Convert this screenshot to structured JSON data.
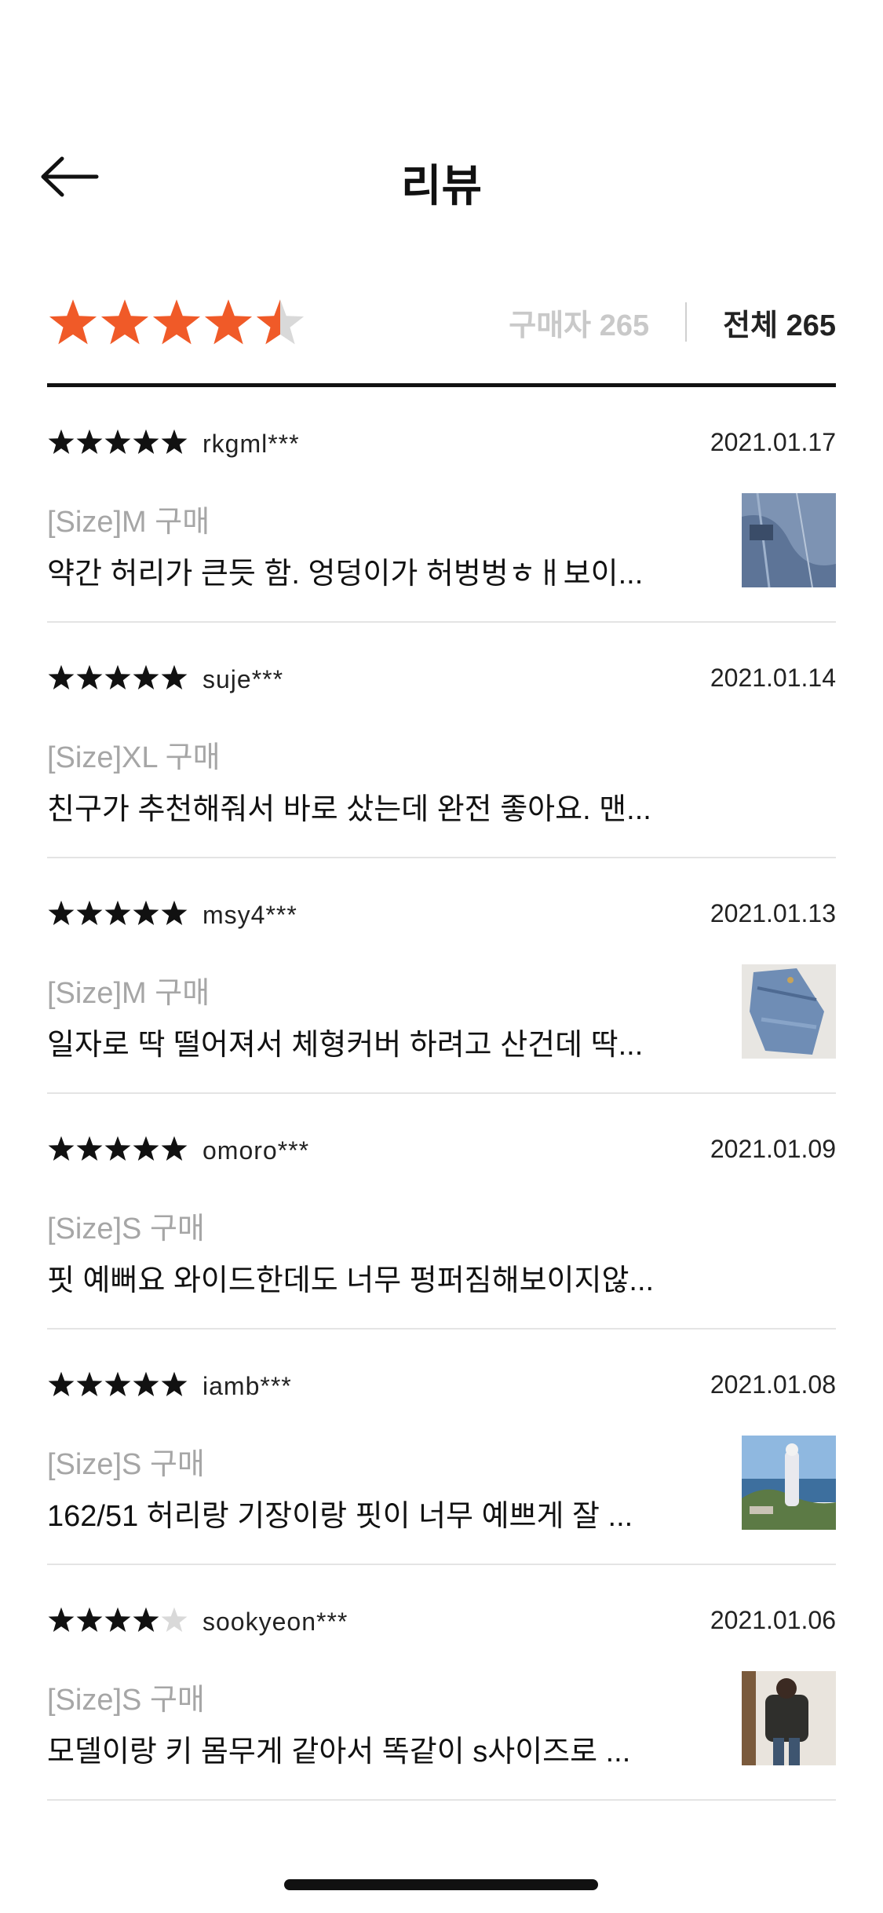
{
  "header": {
    "title": "리뷰",
    "back_icon": "arrow-left-icon"
  },
  "summary": {
    "rating": 4.5,
    "max_rating": 5,
    "star_color": "#f05a28",
    "filters": {
      "buyer_label": "구매자 265",
      "all_label": "전체 265"
    }
  },
  "reviews": [
    {
      "rating": 5,
      "user": "rkgml***",
      "date": "2021.01.17",
      "option": "[Size]M 구매",
      "text": "약간 허리가 큰듯 함. 엉덩이가 허벙벙ㅎㅐ보이...",
      "has_photo": true,
      "photo": "jeans-closeup-photo"
    },
    {
      "rating": 5,
      "user": "suje***",
      "date": "2021.01.14",
      "option": "[Size]XL 구매",
      "text": "친구가 추천해줘서 바로 샀는데 완전 좋아요. 맨...",
      "has_photo": false
    },
    {
      "rating": 5,
      "user": "msy4***",
      "date": "2021.01.13",
      "option": "[Size]M 구매",
      "text": "일자로 딱 떨어져서 체형커버 하려고 산건데 딱...",
      "has_photo": true,
      "photo": "folded-jeans-photo"
    },
    {
      "rating": 5,
      "user": "omoro***",
      "date": "2021.01.09",
      "option": "[Size]S 구매",
      "text": "핏 예뻐요 와이드한데도 너무 펑퍼짐해보이지않...",
      "has_photo": false
    },
    {
      "rating": 5,
      "user": "iamb***",
      "date": "2021.01.08",
      "option": "[Size]S 구매",
      "text": "162/51 허리랑 기장이랑 핏이 너무 예쁘게 잘 ...",
      "has_photo": true,
      "photo": "seaside-photo"
    },
    {
      "rating": 4,
      "user": "sookyeon***",
      "date": "2021.01.06",
      "option": "[Size]S 구매",
      "text": "모델이랑 키 몸무게 같아서 똑같이 s사이즈로 ...",
      "has_photo": true,
      "photo": "mirror-selfie-photo"
    }
  ]
}
